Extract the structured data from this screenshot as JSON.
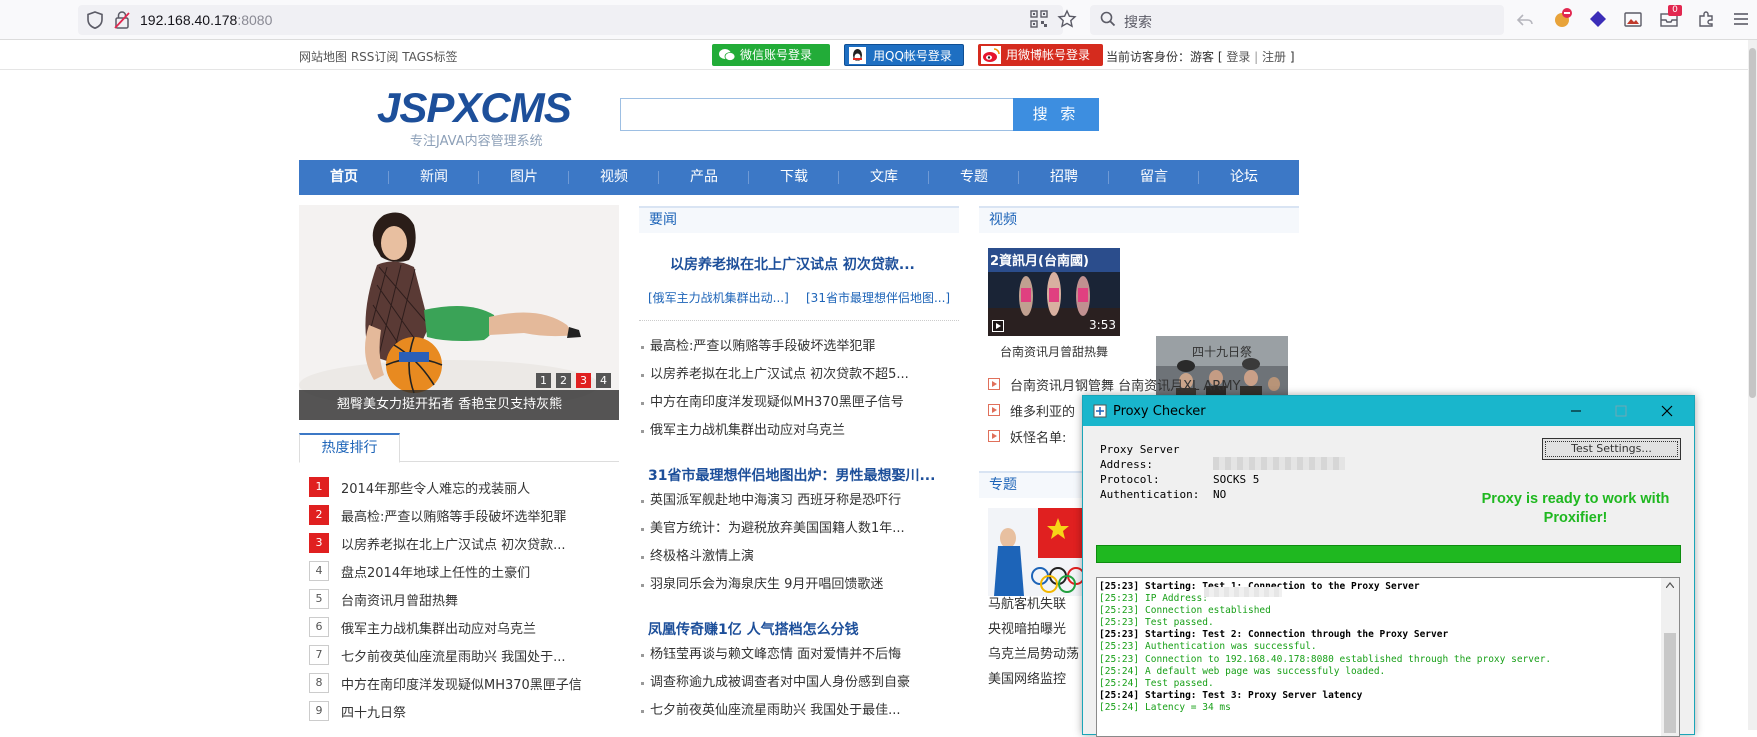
{
  "browser": {
    "url_host": "192.168.40.178",
    "url_port": ":8080",
    "search_placeholder": "搜索",
    "notification_badge": "0"
  },
  "topbar": {
    "links": "网站地图 RSS订阅 TAGS标签",
    "wechat_login": "微信账号登录",
    "qq_login": "用QQ帐号登录",
    "weibo_login": "用微博帐号登录",
    "visitor_prefix": "当前访客身份：游客 [",
    "login": "登录",
    "sep": "|",
    "register": "注册",
    "visitor_suffix": "]"
  },
  "header": {
    "logo": "JSPXCMS",
    "tagline": "专注JAVA内容管理系统",
    "search_button": "搜 索",
    "search_value": ""
  },
  "nav": [
    "首页",
    "新闻",
    "图片",
    "视频",
    "产品",
    "下载",
    "文库",
    "专题",
    "招聘",
    "留言",
    "论坛"
  ],
  "hero": {
    "caption": "翘臀美女力挺开拓者 香艳宝贝支持灰熊",
    "pages": [
      "1",
      "2",
      "3",
      "4"
    ],
    "active_page": "3"
  },
  "hot": {
    "tab": "热度排行",
    "items": [
      {
        "rank": "1",
        "title": "2014年那些令人难忘的戎装丽人"
      },
      {
        "rank": "2",
        "title": "最高检:严查以贿赂等手段破坏选举犯罪"
      },
      {
        "rank": "3",
        "title": "以房养老拟在北上广汉试点 初次贷款..."
      },
      {
        "rank": "4",
        "title": "盘点2014年地球上任性的土豪们"
      },
      {
        "rank": "5",
        "title": "台南资讯月曾甜热舞"
      },
      {
        "rank": "6",
        "title": "俄军主力战机集群出动应对乌克兰"
      },
      {
        "rank": "7",
        "title": "七夕前夜英仙座流星雨助兴 我国处于..."
      },
      {
        "rank": "8",
        "title": "中方在南印度洋发现疑似MH370黑匣子信"
      },
      {
        "rank": "9",
        "title": "四十九日祭"
      }
    ]
  },
  "news": {
    "section": "要闻",
    "headline": "以房养老拟在北上广汉试点 初次贷款...",
    "sub_links": [
      "[俄军主力战机集群出动...]",
      "[31省市最理想伴侣地图...]"
    ],
    "list1": [
      "最高检:严查以贿赂等手段破坏选举犯罪",
      "以房养老拟在北上广汉试点 初次贷款不超5...",
      "中方在南印度洋发现疑似MH370黑匣子信号",
      "俄军主力战机集群出动应对乌克兰"
    ],
    "headline2": "31省市最理想伴侣地图出炉：男性最想娶川...",
    "list2": [
      "英国派军舰赴地中海演习 西班牙称是恐吓行",
      "美官方统计：为避税放弃美国国籍人数1年...",
      "终极格斗激情上演",
      "羽泉同乐会为海泉庆生 9月开唱回馈歌迷"
    ],
    "headline3": "凤凰传奇赚1亿 人气搭档怎么分钱",
    "list3": [
      "杨钰莹再谈与赖文峰恋情 面对爱情并不后悔",
      "调查称逾九成被调查者对中国人身份感到自豪",
      "七夕前夜英仙座流星雨助兴 我国处于最佳..."
    ]
  },
  "video": {
    "section": "视频",
    "thumbs": [
      {
        "caption": "台南资讯月曾甜热舞",
        "duration": "3:53",
        "overlay": "2資訊月(台南國)"
      },
      {
        "caption": "四十九日祭",
        "duration": "",
        "overlay": ""
      }
    ],
    "list": [
      "台南资讯月钢管舞   台南资讯月XL ARMY",
      "维多利亚的",
      "妖怪名单:"
    ]
  },
  "topic": {
    "section": "专题",
    "list": [
      "马航客机失联",
      "央视暗拍曝光",
      "乌克兰局势动荡",
      "美国网络监控"
    ]
  },
  "proxy": {
    "title": "Proxy Checker",
    "label_server": "Proxy Server",
    "label_address": "Address:",
    "label_protocol": "Protocol:",
    "value_protocol": "SOCKS 5",
    "label_auth": "Authentication:",
    "value_auth": "NO",
    "test_button": "Test Settings...",
    "status": "Proxy is ready to work with Proxifier!",
    "progress": 1.0,
    "status_color": "#1fb820",
    "log": [
      {
        "t": "[25:23]",
        "m": "Starting: Test 1: Connection to the Proxy Server",
        "s": "b"
      },
      {
        "t": "[25:23]",
        "m": "IP Address:",
        "s": "g"
      },
      {
        "t": "[25:23]",
        "m": "Connection established",
        "s": "g"
      },
      {
        "t": "[25:23]",
        "m": "Test passed.",
        "s": "g"
      },
      {
        "t": "[25:23]",
        "m": "Starting: Test 2: Connection through the Proxy Server",
        "s": "b"
      },
      {
        "t": "[25:23]",
        "m": "Authentication was successful.",
        "s": "g"
      },
      {
        "t": "[25:23]",
        "m": "Connection to 192.168.40.178:8080 established through the proxy server.",
        "s": "g"
      },
      {
        "t": "[25:24]",
        "m": "A default web page was successfuly loaded.",
        "s": "g"
      },
      {
        "t": "[25:24]",
        "m": "Test passed.",
        "s": "g"
      },
      {
        "t": "[25:24]",
        "m": "Starting: Test 3: Proxy Server latency",
        "s": "b"
      },
      {
        "t": "[25:24]",
        "m": "Latency = 34 ms",
        "s": "g"
      }
    ]
  },
  "colors": {
    "nav": "#3c78c6",
    "logo": "#1d4f9a",
    "proxy_title": "#19b6cc",
    "wechat": "#22ac38",
    "qq": "#1e6fc2",
    "weibo": "#d52b1e"
  }
}
